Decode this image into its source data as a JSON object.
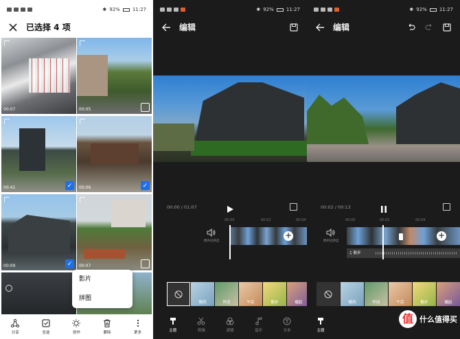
{
  "status": {
    "battery": "92%",
    "time": "11:27"
  },
  "picker": {
    "title": "已选择 4 项",
    "tiles": [
      {
        "duration": "00:07",
        "checked": false
      },
      {
        "duration": "00:05",
        "checked": false
      },
      {
        "duration": "00:41",
        "checked": true
      },
      {
        "duration": "00:06",
        "checked": true
      },
      {
        "duration": "00:09",
        "checked": true
      },
      {
        "duration": "00:07",
        "checked": false
      }
    ],
    "popup": [
      "影片",
      "拼图"
    ],
    "bottom": [
      "分享",
      "全选",
      "创作",
      "删除",
      "更多"
    ]
  },
  "editor_a": {
    "title": "编辑",
    "time_readout": "00:00 / 01:07",
    "ticks": [
      "00:00",
      "00:02",
      "00:04"
    ],
    "audio_label": "原声已开启",
    "state": "paused"
  },
  "editor_b": {
    "title": "编辑",
    "time_readout": "00:02 / 00:13",
    "ticks": [
      "00:00",
      "00:02",
      "00:04"
    ],
    "audio_label": "原声已开启",
    "music": "♫ 散步",
    "state": "playing"
  },
  "filters": [
    "None",
    "微风",
    "怀旧",
    "午后",
    "散步",
    "崛起"
  ],
  "editor_tabs": [
    "主题",
    "剪辑",
    "滤镜",
    "音乐",
    "文本"
  ],
  "watermark": {
    "logo": "值",
    "text": "什么值得买"
  },
  "colors": {
    "accent_check": "#1f6fe5",
    "editor_bg": "#1b1b1b"
  }
}
